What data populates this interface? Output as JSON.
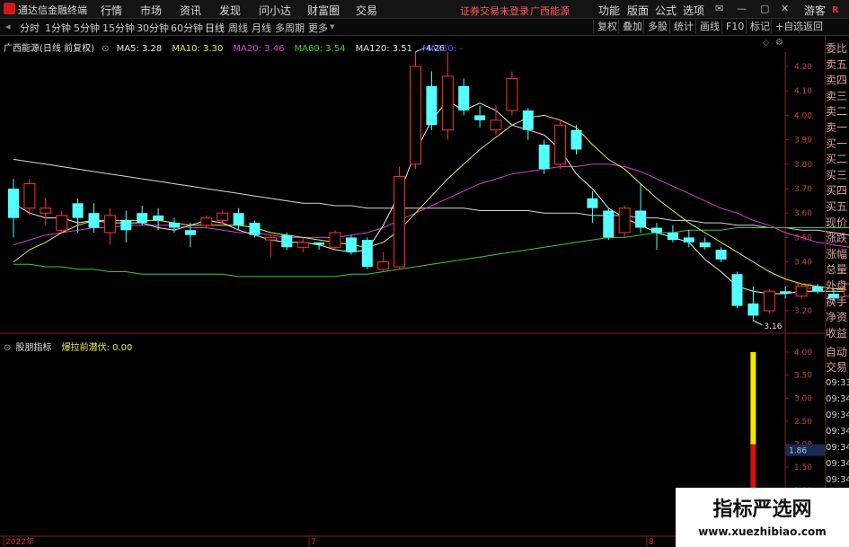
{
  "titlebar": {
    "app_name": "通达信金融终端",
    "menu": [
      "行情",
      "市场",
      "资讯",
      "发现",
      "问小达",
      "财富圈",
      "交易"
    ],
    "notice": "证券交易未登录",
    "stock_name": "广西能源",
    "right_menu": [
      "功能",
      "版面",
      "公式",
      "选项"
    ],
    "user": "游客",
    "badge": "R"
  },
  "toolbar": {
    "periods": [
      "分时",
      "1分钟",
      "5分钟",
      "15分钟",
      "30分钟",
      "60分钟",
      "日线",
      "周线",
      "月线",
      "多周期",
      "更多"
    ],
    "active_period": "日线",
    "buttons": [
      "复权",
      "叠加",
      "多股",
      "统计",
      "画线",
      "F10",
      "标记",
      "+自选",
      "返回"
    ]
  },
  "main_legend": {
    "title": "广西能源(日线 前复权)",
    "items": [
      {
        "label": "MA5: 3.28",
        "color": "#e8e8e8"
      },
      {
        "label": "MA10: 3.30",
        "color": "#e8e85a"
      },
      {
        "label": "MA20: 3.46",
        "color": "#e040e0"
      },
      {
        "label": "MA60: 3.54",
        "color": "#40d040"
      },
      {
        "label": "MA120: 3.51",
        "color": "#e8e8e8"
      },
      {
        "label": "MA250: -",
        "color": "#4060ff"
      }
    ]
  },
  "price_axis": [
    "4.20",
    "4.10",
    "4.00",
    "3.90",
    "3.80",
    "3.70",
    "3.60",
    "3.50",
    "3.40",
    "3.30",
    "3.20"
  ],
  "annotations": {
    "high": "4.26",
    "low": "3.16"
  },
  "sub_legend": {
    "title": "股朋指标",
    "label": "爆拉前潜伏: 0.00"
  },
  "sub_axis": [
    "4.00",
    "3.50",
    "3.00",
    "2.50",
    "2.00",
    "1.50",
    "1.00",
    "0.50"
  ],
  "sub_value_tag": "1.86",
  "date_labels": [
    "2022年",
    "7",
    "8"
  ],
  "side_panel": {
    "items": [
      "委比",
      "卖五",
      "卖四",
      "卖三",
      "卖二",
      "卖一",
      "买一",
      "买二",
      "买三",
      "买四",
      "买五",
      "现价",
      "涨跌",
      "涨幅",
      "总量",
      "外盘",
      "换手",
      "净资",
      "收益"
    ],
    "auto_label": [
      "自动",
      "交易"
    ],
    "times": [
      "09:33",
      "09:34",
      "09:34",
      "09:34",
      "09:34",
      "09:34",
      "09:34",
      "09:34",
      "09:34"
    ]
  },
  "watermark": {
    "title": "指标严选网",
    "url": "www.xuezhibiao.com"
  },
  "chart_data": {
    "type": "candlestick",
    "y_axis_range": [
      3.16,
      4.26
    ],
    "candles": [
      [
        3.7,
        3.58,
        3.74,
        3.5
      ],
      [
        3.62,
        3.72,
        3.74,
        3.59
      ],
      [
        3.6,
        3.62,
        3.66,
        3.55
      ],
      [
        3.53,
        3.59,
        3.61,
        3.52
      ],
      [
        3.64,
        3.58,
        3.66,
        3.52
      ],
      [
        3.6,
        3.54,
        3.64,
        3.52
      ],
      [
        3.52,
        3.59,
        3.62,
        3.47
      ],
      [
        3.57,
        3.53,
        3.61,
        3.48
      ],
      [
        3.6,
        3.56,
        3.63,
        3.55
      ],
      [
        3.59,
        3.57,
        3.62,
        3.53
      ],
      [
        3.56,
        3.54,
        3.58,
        3.52
      ],
      [
        3.53,
        3.51,
        3.56,
        3.46
      ],
      [
        3.55,
        3.58,
        3.59,
        3.54
      ],
      [
        3.57,
        3.6,
        3.61,
        3.55
      ],
      [
        3.6,
        3.55,
        3.62,
        3.53
      ],
      [
        3.56,
        3.51,
        3.57,
        3.5
      ],
      [
        3.49,
        3.5,
        3.51,
        3.42
      ],
      [
        3.51,
        3.46,
        3.52,
        3.45
      ],
      [
        3.46,
        3.48,
        3.5,
        3.44
      ],
      [
        3.48,
        3.47,
        3.48,
        3.45
      ],
      [
        3.46,
        3.52,
        3.53,
        3.45
      ],
      [
        3.5,
        3.44,
        3.51,
        3.43
      ],
      [
        3.49,
        3.38,
        3.5,
        3.37
      ],
      [
        3.37,
        3.4,
        3.44,
        3.36
      ],
      [
        3.38,
        3.75,
        3.79,
        3.37
      ],
      [
        3.8,
        4.2,
        4.26,
        3.78
      ],
      [
        4.12,
        3.96,
        4.18,
        3.94
      ],
      [
        3.94,
        4.16,
        4.26,
        3.9
      ],
      [
        4.12,
        4.02,
        4.15,
        4.0
      ],
      [
        4.0,
        3.98,
        4.04,
        3.95
      ],
      [
        3.94,
        3.98,
        4.04,
        3.92
      ],
      [
        4.02,
        4.15,
        4.18,
        4.0
      ],
      [
        4.02,
        3.94,
        4.03,
        3.9
      ],
      [
        3.88,
        3.78,
        3.9,
        3.76
      ],
      [
        3.8,
        3.96,
        3.98,
        3.78
      ],
      [
        3.94,
        3.86,
        3.96,
        3.84
      ],
      [
        3.66,
        3.62,
        3.69,
        3.56
      ],
      [
        3.61,
        3.5,
        3.62,
        3.49
      ],
      [
        3.52,
        3.62,
        3.63,
        3.5
      ],
      [
        3.61,
        3.54,
        3.72,
        3.52
      ],
      [
        3.54,
        3.52,
        3.56,
        3.45
      ],
      [
        3.52,
        3.49,
        3.55,
        3.48
      ],
      [
        3.5,
        3.48,
        3.53,
        3.46
      ],
      [
        3.48,
        3.46,
        3.5,
        3.45
      ],
      [
        3.45,
        3.41,
        3.46,
        3.4
      ],
      [
        3.35,
        3.22,
        3.36,
        3.21
      ],
      [
        3.23,
        3.18,
        3.3,
        3.16
      ],
      [
        3.2,
        3.28,
        3.29,
        3.19
      ],
      [
        3.28,
        3.27,
        3.3,
        3.25
      ],
      [
        3.26,
        3.3,
        3.31,
        3.25
      ],
      [
        3.3,
        3.28,
        3.31,
        3.27
      ],
      [
        3.27,
        3.25,
        3.29,
        3.24
      ],
      [
        3.26,
        3.31,
        3.32,
        3.25
      ]
    ],
    "ma5": [
      3.64,
      3.6,
      3.58,
      3.58,
      3.56,
      3.57,
      3.56,
      3.56,
      3.56,
      3.54,
      3.53,
      3.55,
      3.57,
      3.56,
      3.53,
      3.51,
      3.49,
      3.48,
      3.48,
      3.47,
      3.45,
      3.44,
      3.45,
      3.55,
      3.68,
      3.85,
      3.98,
      4.06,
      4.02,
      4.05,
      4.02,
      3.96,
      3.94,
      3.92,
      3.86,
      3.76,
      3.7,
      3.62,
      3.58,
      3.55,
      3.52,
      3.5,
      3.48,
      3.41,
      3.36,
      3.3,
      3.28,
      3.27,
      3.27,
      3.28,
      3.28,
      3.28,
      3.28
    ],
    "ma10": [
      3.4,
      3.45,
      3.48,
      3.52,
      3.55,
      3.57,
      3.57,
      3.57,
      3.57,
      3.57,
      3.56,
      3.55,
      3.55,
      3.55,
      3.55,
      3.54,
      3.52,
      3.51,
      3.5,
      3.49,
      3.48,
      3.47,
      3.46,
      3.48,
      3.53,
      3.6,
      3.67,
      3.74,
      3.8,
      3.86,
      3.91,
      3.96,
      3.99,
      4.0,
      3.98,
      3.95,
      3.88,
      3.82,
      3.78,
      3.72,
      3.66,
      3.61,
      3.56,
      3.52,
      3.48,
      3.44,
      3.4,
      3.36,
      3.33,
      3.31,
      3.3,
      3.29,
      3.29
    ],
    "ma20": [
      3.47,
      3.49,
      3.51,
      3.52,
      3.53,
      3.54,
      3.54,
      3.55,
      3.55,
      3.55,
      3.55,
      3.54,
      3.54,
      3.53,
      3.52,
      3.52,
      3.51,
      3.5,
      3.5,
      3.5,
      3.5,
      3.51,
      3.52,
      3.54,
      3.57,
      3.6,
      3.63,
      3.66,
      3.69,
      3.72,
      3.74,
      3.76,
      3.77,
      3.78,
      3.79,
      3.79,
      3.8,
      3.8,
      3.79,
      3.77,
      3.74,
      3.71,
      3.68,
      3.65,
      3.62,
      3.6,
      3.57,
      3.55,
      3.52,
      3.5,
      3.48,
      3.47,
      3.46
    ],
    "ma60": [
      3.39,
      3.39,
      3.38,
      3.38,
      3.37,
      3.37,
      3.36,
      3.36,
      3.35,
      3.35,
      3.35,
      3.35,
      3.35,
      3.35,
      3.34,
      3.34,
      3.34,
      3.34,
      3.34,
      3.34,
      3.34,
      3.35,
      3.35,
      3.36,
      3.37,
      3.38,
      3.39,
      3.4,
      3.41,
      3.42,
      3.43,
      3.44,
      3.45,
      3.46,
      3.47,
      3.48,
      3.49,
      3.5,
      3.5,
      3.51,
      3.52,
      3.52,
      3.53,
      3.53,
      3.53,
      3.54,
      3.54,
      3.54,
      3.54,
      3.54,
      3.54,
      3.54,
      3.54
    ],
    "ma120": [
      3.82,
      3.81,
      3.8,
      3.79,
      3.78,
      3.77,
      3.76,
      3.75,
      3.74,
      3.73,
      3.72,
      3.71,
      3.7,
      3.69,
      3.68,
      3.67,
      3.66,
      3.65,
      3.64,
      3.64,
      3.63,
      3.63,
      3.62,
      3.62,
      3.62,
      3.62,
      3.62,
      3.62,
      3.62,
      3.61,
      3.61,
      3.61,
      3.61,
      3.6,
      3.6,
      3.6,
      3.59,
      3.59,
      3.59,
      3.58,
      3.58,
      3.57,
      3.57,
      3.56,
      3.56,
      3.55,
      3.55,
      3.54,
      3.54,
      3.53,
      3.53,
      3.52,
      3.51
    ],
    "sub_indicator": {
      "max": 4.0,
      "bar_index": 46,
      "yellow_range": [
        2.0,
        4.0
      ],
      "red_range": [
        0,
        2.0
      ],
      "value": 0.0
    }
  }
}
